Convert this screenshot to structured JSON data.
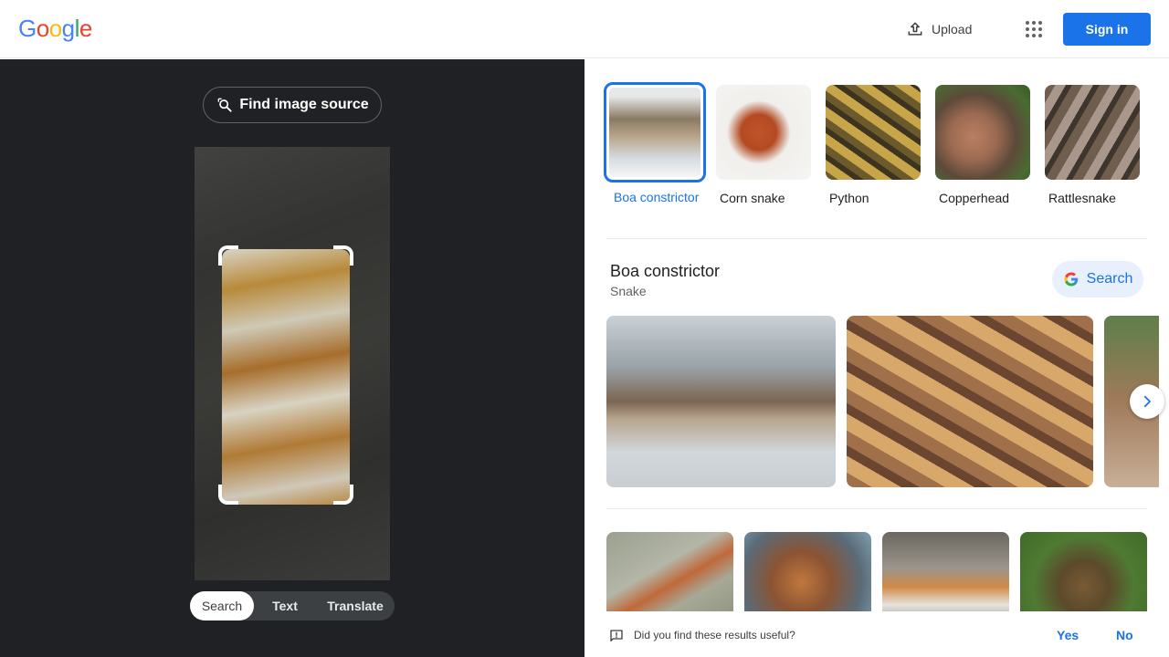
{
  "header": {
    "logo": [
      "G",
      "o",
      "o",
      "g",
      "l",
      "e"
    ],
    "logo_colors": [
      "#4285f4",
      "#ea4335",
      "#fbbc05",
      "#4285f4",
      "#34a853",
      "#ea4335"
    ],
    "upload_label": "Upload",
    "signin_label": "Sign in",
    "apps_icon": "apps-grid-icon",
    "upload_icon": "upload-icon"
  },
  "left_panel": {
    "find_source_label": "Find image source",
    "find_source_icon": "lens-search-icon",
    "modes": [
      {
        "label": "Search",
        "active": true
      },
      {
        "label": "Text",
        "active": false
      },
      {
        "label": "Translate",
        "active": false
      }
    ]
  },
  "right_panel": {
    "chips": [
      {
        "label": "Boa constrictor",
        "selected": true
      },
      {
        "label": "Corn snake",
        "selected": false
      },
      {
        "label": "Python",
        "selected": false
      },
      {
        "label": "Copperhead",
        "selected": false
      },
      {
        "label": "Rattlesnake",
        "selected": false
      }
    ],
    "entity": {
      "title": "Boa constrictor",
      "subtitle": "Snake",
      "search_label": "Search"
    },
    "feedback": {
      "question": "Did you find these results useful?",
      "yes": "Yes",
      "no": "No"
    }
  },
  "colors": {
    "accent": "#1a73e8",
    "dark_panel": "#202124"
  }
}
